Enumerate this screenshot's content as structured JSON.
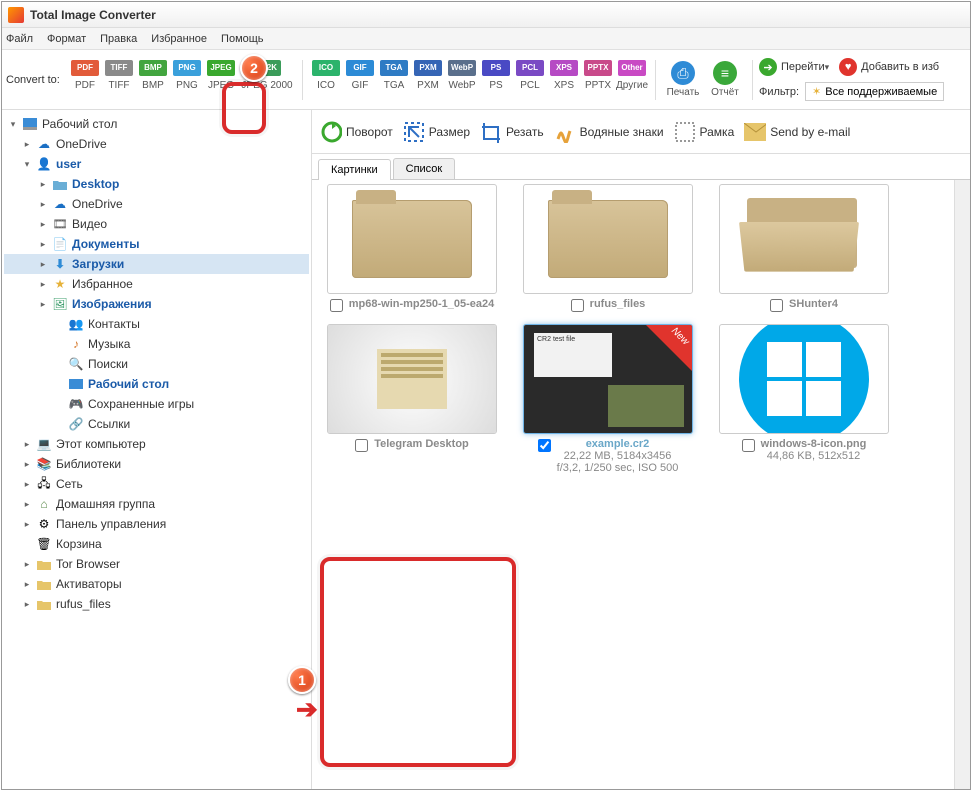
{
  "title": "Total Image Converter",
  "menu": [
    "Файл",
    "Формат",
    "Правка",
    "Избранное",
    "Помощь"
  ],
  "convert_label": "Convert to:",
  "formats": [
    {
      "code": "PDF",
      "label": "PDF",
      "color": "#e25b3a"
    },
    {
      "code": "TIFF",
      "label": "TIFF",
      "color": "#8a8a8a"
    },
    {
      "code": "BMP",
      "label": "BMP",
      "color": "#42a53f"
    },
    {
      "code": "PNG",
      "label": "PNG",
      "color": "#3aa0db"
    },
    {
      "code": "JPEG",
      "label": "JPEG",
      "color": "#3aa82e"
    },
    {
      "code": "JP2K",
      "label": "JPEG 2000",
      "color": "#3a9c5a"
    },
    {
      "code": "ICO",
      "label": "ICO",
      "color": "#2bb36b"
    },
    {
      "code": "GIF",
      "label": "GIF",
      "color": "#2c8bd6"
    },
    {
      "code": "TGA",
      "label": "TGA",
      "color": "#2e7bc4"
    },
    {
      "code": "PXM",
      "label": "PXM",
      "color": "#3565b5"
    },
    {
      "code": "WebP",
      "label": "WebP",
      "color": "#5a6f8c"
    },
    {
      "code": "PS",
      "label": "PS",
      "color": "#4a4ac4"
    },
    {
      "code": "PCL",
      "label": "PCL",
      "color": "#7a4ac4"
    },
    {
      "code": "XPS",
      "label": "XPS",
      "color": "#b64ac4"
    },
    {
      "code": "PPTX",
      "label": "PPTX",
      "color": "#c94a8a"
    },
    {
      "code": "Other",
      "label": "Другие",
      "color": "#c94ac4"
    }
  ],
  "print_label": "Печать",
  "report_label": "Отчёт",
  "filter_label": "Фильтр:",
  "nav_go": "Перейти",
  "nav_fav": "Добавить в изб",
  "filter_btn": "Все поддерживаемые",
  "tree": [
    {
      "txt": "Рабочий стол",
      "ico": "desktop",
      "bold": false,
      "indent": 0,
      "arrow": "▾"
    },
    {
      "txt": "OneDrive",
      "ico": "onedrive",
      "bold": false,
      "indent": 1,
      "arrow": "▸"
    },
    {
      "txt": "user",
      "ico": "user",
      "bold": true,
      "indent": 1,
      "arrow": "▾"
    },
    {
      "txt": "Desktop",
      "ico": "folder-blue",
      "bold": true,
      "indent": 2,
      "arrow": "▸"
    },
    {
      "txt": "OneDrive",
      "ico": "onedrive",
      "bold": false,
      "indent": 2,
      "arrow": "▸"
    },
    {
      "txt": "Видео",
      "ico": "video",
      "bold": false,
      "indent": 2,
      "arrow": "▸"
    },
    {
      "txt": "Документы",
      "ico": "doc",
      "bold": true,
      "indent": 2,
      "arrow": "▸"
    },
    {
      "txt": "Загрузки",
      "ico": "download",
      "bold": true,
      "indent": 2,
      "arrow": "▸",
      "sel": true
    },
    {
      "txt": "Избранное",
      "ico": "star",
      "bold": false,
      "indent": 2,
      "arrow": "▸"
    },
    {
      "txt": "Изображения",
      "ico": "images",
      "bold": true,
      "indent": 2,
      "arrow": "▸"
    },
    {
      "txt": "Контакты",
      "ico": "contacts",
      "bold": false,
      "indent": 3,
      "arrow": ""
    },
    {
      "txt": "Музыка",
      "ico": "music",
      "bold": false,
      "indent": 3,
      "arrow": ""
    },
    {
      "txt": "Поиски",
      "ico": "search",
      "bold": false,
      "indent": 3,
      "arrow": ""
    },
    {
      "txt": "Рабочий стол",
      "ico": "desktop-blue",
      "bold": true,
      "indent": 3,
      "arrow": ""
    },
    {
      "txt": "Сохраненные игры",
      "ico": "games",
      "bold": false,
      "indent": 3,
      "arrow": ""
    },
    {
      "txt": "Ссылки",
      "ico": "links",
      "bold": false,
      "indent": 3,
      "arrow": ""
    },
    {
      "txt": "Этот компьютер",
      "ico": "computer",
      "bold": false,
      "indent": 1,
      "arrow": "▸"
    },
    {
      "txt": "Библиотеки",
      "ico": "lib",
      "bold": false,
      "indent": 1,
      "arrow": "▸"
    },
    {
      "txt": "Сеть",
      "ico": "network",
      "bold": false,
      "indent": 1,
      "arrow": "▸"
    },
    {
      "txt": "Домашняя группа",
      "ico": "home",
      "bold": false,
      "indent": 1,
      "arrow": "▸"
    },
    {
      "txt": "Панель управления",
      "ico": "panel",
      "bold": false,
      "indent": 1,
      "arrow": "▸"
    },
    {
      "txt": "Корзина",
      "ico": "trash",
      "bold": false,
      "indent": 1,
      "arrow": ""
    },
    {
      "txt": "Tor Browser",
      "ico": "folder",
      "bold": false,
      "indent": 1,
      "arrow": "▸"
    },
    {
      "txt": "Активаторы",
      "ico": "folder",
      "bold": false,
      "indent": 1,
      "arrow": "▸"
    },
    {
      "txt": "rufus_files",
      "ico": "folder",
      "bold": false,
      "indent": 1,
      "arrow": "▸"
    }
  ],
  "actions": [
    {
      "label": "Поворот",
      "name": "rotate"
    },
    {
      "label": "Размер",
      "name": "resize"
    },
    {
      "label": "Резать",
      "name": "crop"
    },
    {
      "label": "Водяные знаки",
      "name": "watermark"
    },
    {
      "label": "Рамка",
      "name": "frame"
    },
    {
      "label": "Send by e-mail",
      "name": "email"
    }
  ],
  "tabs": {
    "pics": "Картинки",
    "list": "Список"
  },
  "items": [
    {
      "name": "mp68-win-mp250-1_05-ea24",
      "type": "folder",
      "checked": false
    },
    {
      "name": "rufus_files",
      "type": "folder",
      "checked": false
    },
    {
      "name": "SHunter4",
      "type": "folder-open",
      "checked": false
    },
    {
      "name": "Telegram Desktop",
      "type": "telegram",
      "checked": false
    },
    {
      "name": "example.cr2",
      "type": "cr2",
      "checked": true,
      "selected": true,
      "meta1": "22,22 MB, 5184x3456",
      "meta2": "f/3,2, 1/250 sec, ISO 500",
      "new": true,
      "cr2label": "CR2 test file"
    },
    {
      "name": "windows-8-icon.png",
      "type": "win",
      "checked": false,
      "meta1": "44,86 KB, 512x512"
    }
  ],
  "new_label": "New"
}
